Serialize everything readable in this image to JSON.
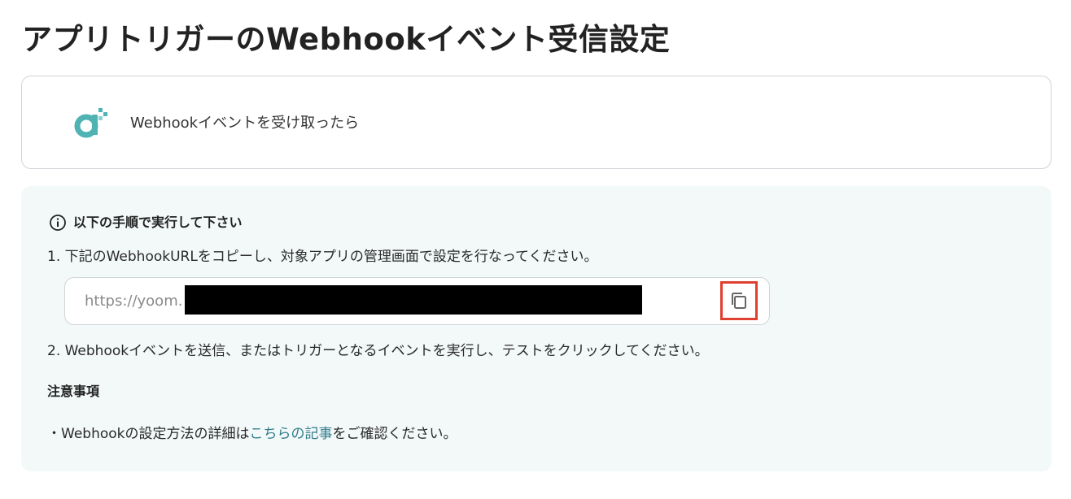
{
  "page": {
    "title": "アプリトリガーのWebhookイベント受信設定"
  },
  "trigger": {
    "app_icon": "yoom-logo-icon",
    "label": "Webhookイベントを受け取ったら"
  },
  "instructions": {
    "icon": "info-circle-icon",
    "heading": "以下の手順で実行して下さい",
    "step1": "1. 下記のWebhookURLをコピーし、対象アプリの管理画面で設定を行なってください。",
    "url_value": "https://yoom.",
    "copy_icon": "copy-icon",
    "step2": "2. Webhookイベントを送信、またはトリガーとなるイベントを実行し、テストをクリックしてください。"
  },
  "notes": {
    "heading": "注意事項",
    "prefix": "・Webhookの設定方法の詳細は",
    "link_text": "こちらの記事",
    "suffix": "をご確認ください。"
  },
  "colors": {
    "accent_teal": "#4fb3b3",
    "link": "#2f7d8c",
    "highlight_border": "#e0402f",
    "panel_background": "#f3f8f8"
  }
}
